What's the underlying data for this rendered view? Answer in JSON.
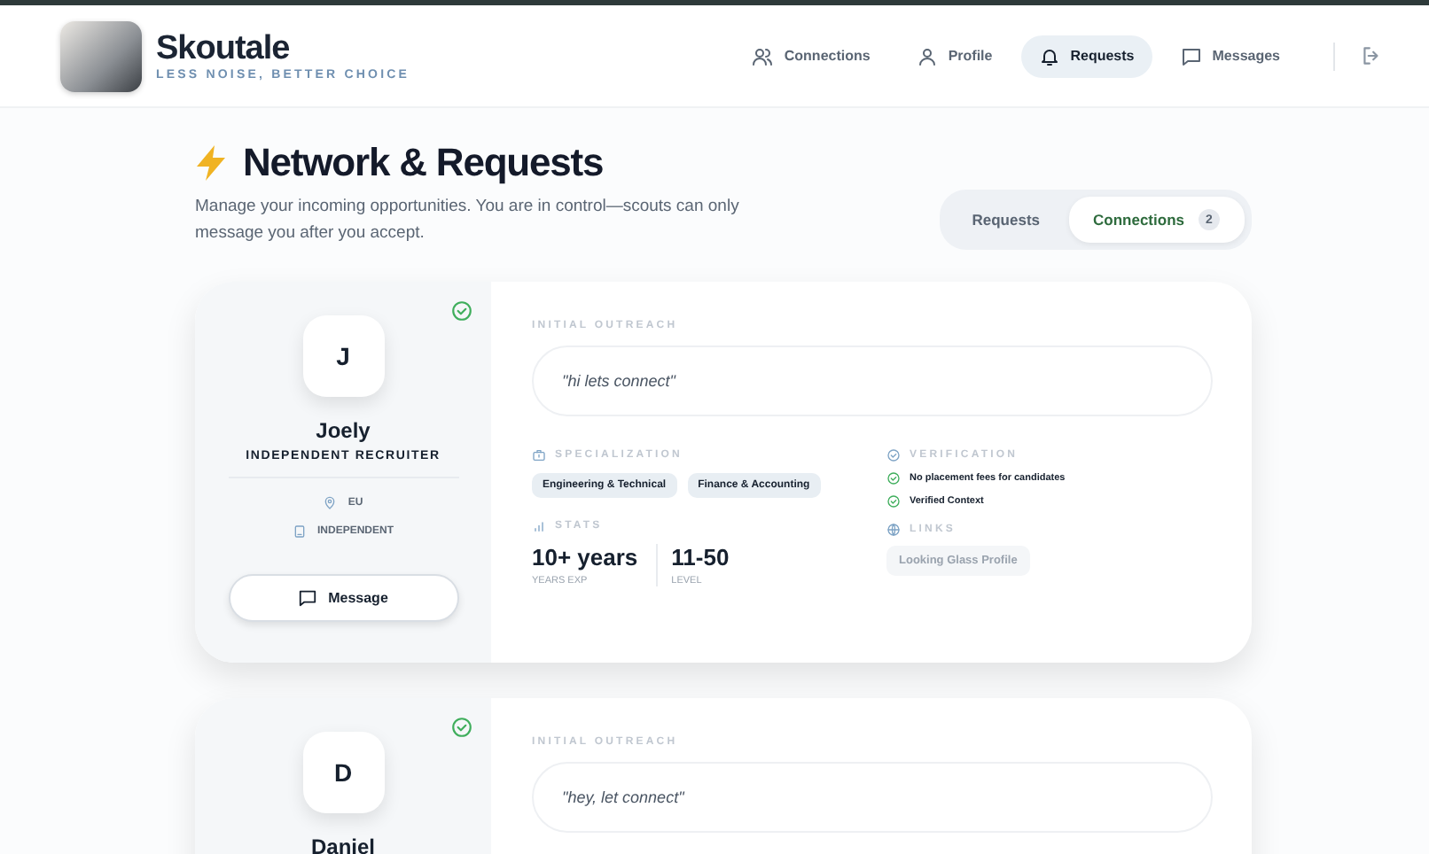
{
  "brand": {
    "name": "Skoutale",
    "tagline": "LESS NOISE, BETTER CHOICE"
  },
  "nav": [
    {
      "kind": "people",
      "label": "Connections",
      "selected": false
    },
    {
      "kind": "person",
      "label": "Profile",
      "selected": false
    },
    {
      "kind": "bell",
      "label": "Requests",
      "selected": true
    },
    {
      "kind": "chat",
      "label": "Messages",
      "selected": false
    }
  ],
  "page": {
    "title": "Network & Requests",
    "subtitle": "Manage your incoming opportunities. You are in control—scouts can only message you after you accept."
  },
  "view_toggle": [
    {
      "label": "Requests",
      "selected": false
    },
    {
      "label": "Connections",
      "count": "2",
      "selected": true
    }
  ],
  "cards": [
    {
      "initial": "J",
      "name": "Joely",
      "role": "INDEPENDENT RECRUITER",
      "verified": true,
      "location": "EU",
      "type": "INDEPENDENT",
      "button": "Message",
      "outreach_label": "INITIAL OUTREACH",
      "message": "\"hi lets connect\"",
      "specialization_label": "SPECIALIZATION",
      "tags": [
        "Engineering & Technical",
        "Finance & Accounting"
      ],
      "stats_label": "STATS",
      "stats": [
        {
          "value": "10+ years",
          "label": "YEARS EXP"
        },
        {
          "value": "11-50",
          "label": "LEVEL"
        }
      ],
      "verification_label": "VERIFICATION",
      "verification_items": [
        "No placement fees for candidates",
        "Verified Context"
      ],
      "links_label": "LINKS",
      "links": [
        "Looking Glass Profile"
      ]
    },
    {
      "initial": "D",
      "name": "Daniel",
      "verified": true,
      "outreach_label": "INITIAL OUTREACH",
      "message": "\"hey, let connect\""
    }
  ]
}
